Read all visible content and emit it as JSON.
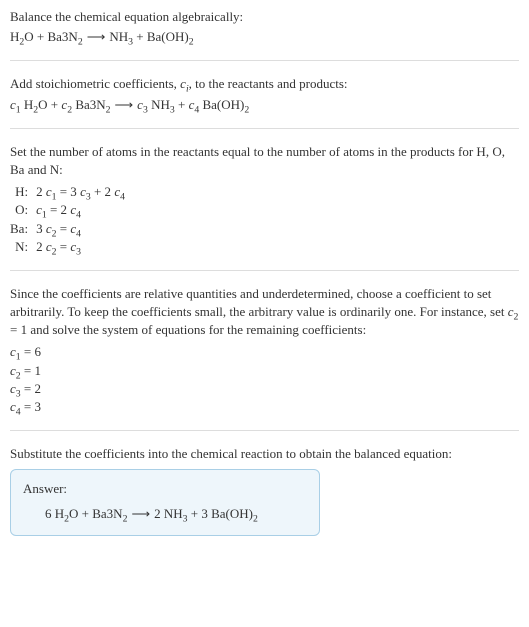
{
  "s1": {
    "intro": "Balance the chemical equation algebraically:",
    "eq": "H₂O + Ba3N₂  ⟶  NH₃ + Ba(OH)₂"
  },
  "s2": {
    "intro_a": "Add stoichiometric coefficients, ",
    "intro_ci": "c",
    "intro_ci_sub": "i",
    "intro_b": ", to the reactants and products:",
    "eq": "c₁ H₂O + c₂ Ba3N₂  ⟶  c₃ NH₃ + c₄ Ba(OH)₂"
  },
  "s3": {
    "intro": "Set the number of atoms in the reactants equal to the number of atoms in the products for H, O, Ba and N:",
    "rows": [
      {
        "el": "H:",
        "eq": "2 c₁ = 3 c₃ + 2 c₄"
      },
      {
        "el": "O:",
        "eq": "c₁ = 2 c₄"
      },
      {
        "el": "Ba:",
        "eq": "3 c₂ = c₄"
      },
      {
        "el": "N:",
        "eq": "2 c₂ = c₃"
      }
    ]
  },
  "s4": {
    "intro": "Since the coefficients are relative quantities and underdetermined, choose a coefficient to set arbitrarily. To keep the coefficients small, the arbitrary value is ordinarily one. For instance, set c₂ = 1 and solve the system of equations for the remaining coefficients:",
    "coeffs": [
      "c₁ = 6",
      "c₂ = 1",
      "c₃ = 2",
      "c₄ = 3"
    ]
  },
  "s5": {
    "intro": "Substitute the coefficients into the chemical reaction to obtain the balanced equation:",
    "answer_label": "Answer:",
    "answer_eq": "6 H₂O + Ba3N₂  ⟶  2 NH₃ + 3 Ba(OH)₂"
  }
}
